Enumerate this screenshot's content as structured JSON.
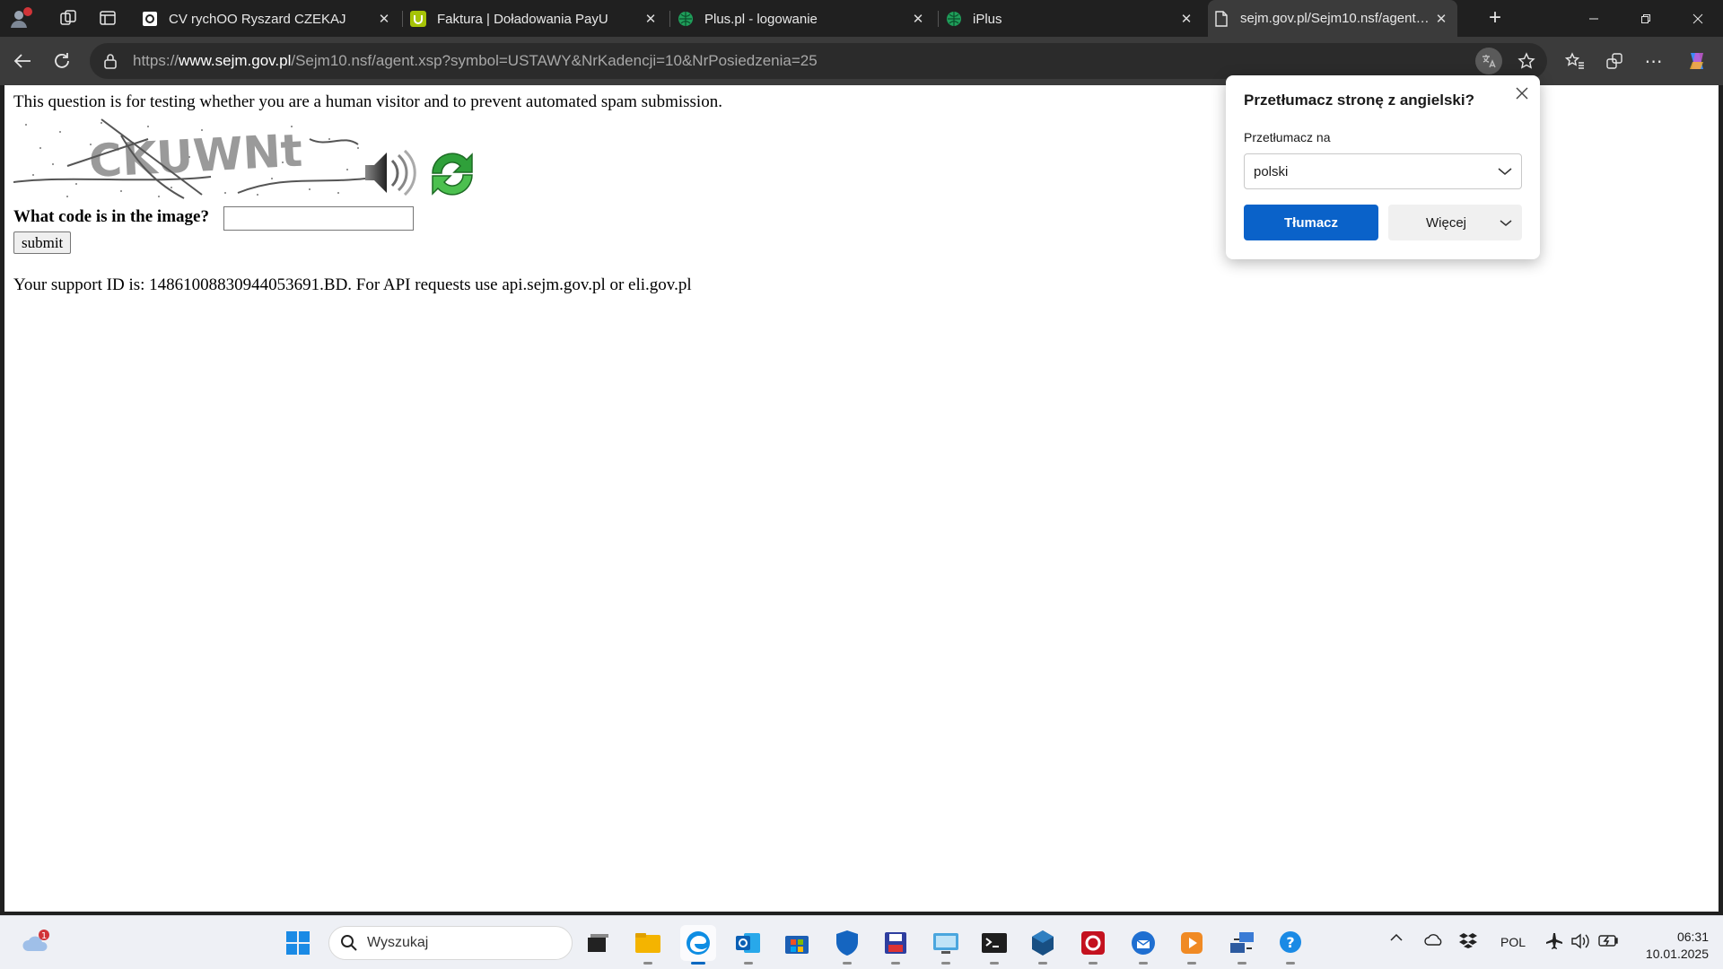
{
  "browser": {
    "tabs": [
      {
        "title": "CV rychOO Ryszard CZEKAJ",
        "icon": "document-page-icon",
        "active": false
      },
      {
        "title": "Faktura | Doładowania PayU",
        "icon": "payu-icon",
        "active": false
      },
      {
        "title": "Plus.pl - logowanie",
        "icon": "plus-globe-icon",
        "active": false
      },
      {
        "title": "iPlus",
        "icon": "plus-globe-icon",
        "active": false
      },
      {
        "title": "sejm.gov.pl/Sejm10.nsf/agent.xsp",
        "icon": "blank-page-icon",
        "active": true
      }
    ],
    "address": {
      "scheme": "https://",
      "host": "www.sejm.gov.pl",
      "path": "/Sejm10.nsf/agent.xsp?symbol=USTAWY&NrKadencji=10&NrPosiedzenia=25"
    }
  },
  "page": {
    "question": "This question is for testing whether you are a human visitor and to prevent automated spam submission.",
    "captcha_text": "CKUWNt",
    "code_label": "What code is in the image?",
    "code_input_value": "",
    "submit_label": "submit",
    "support_text": "Your support ID is: 14861008830944053691.BD. For API requests use api.sejm.gov.pl or eli.gov.pl"
  },
  "translate_popup": {
    "title": "Przetłumacz stronę z angielski?",
    "target_label": "Przetłumacz na",
    "target_value": "polski",
    "primary_button": "Tłumacz",
    "more_button": "Więcej"
  },
  "taskbar": {
    "search_placeholder": "Wyszukaj",
    "weather_badge": "1",
    "language": "POL",
    "time": "06:31",
    "date": "10.01.2025"
  },
  "colors": {
    "accent": "#0a62c9",
    "tab_active": "#3b3b3b",
    "titlebar": "#202020"
  }
}
